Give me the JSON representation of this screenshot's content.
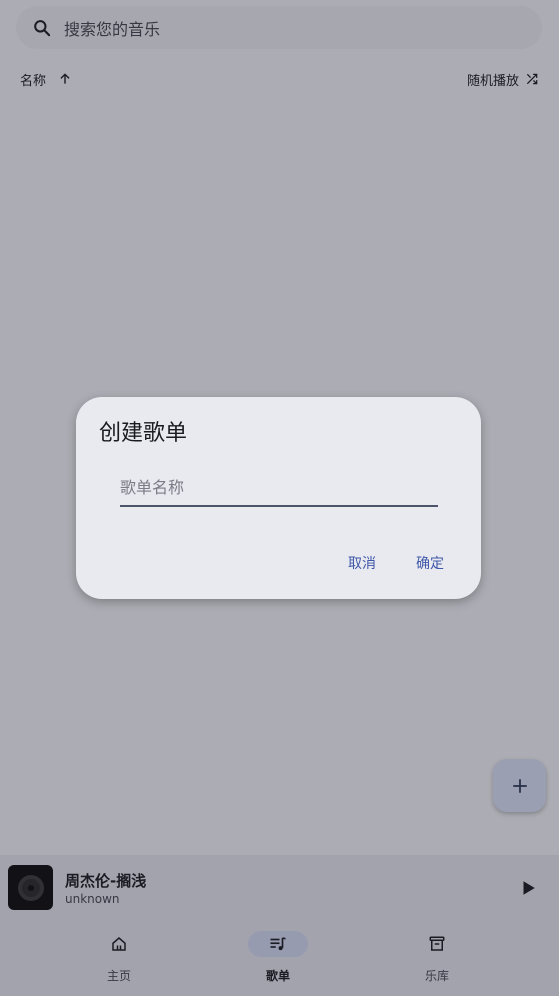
{
  "search": {
    "placeholder": "搜索您的音乐",
    "icon": "search-icon"
  },
  "sort": {
    "label": "名称",
    "direction_icon": "arrow-up-icon",
    "shuffle_label": "随机播放",
    "shuffle_icon": "shuffle-icon"
  },
  "fab": {
    "icon": "plus-icon"
  },
  "player": {
    "title": "周杰伦-搁浅",
    "artist": "unknown",
    "cover_icon": "vinyl-record-icon",
    "play_icon": "play-icon"
  },
  "nav": {
    "items": [
      {
        "label": "主页",
        "icon": "home-icon",
        "active": false
      },
      {
        "label": "歌单",
        "icon": "playlist-icon",
        "active": true
      },
      {
        "label": "乐库",
        "icon": "library-icon",
        "active": false
      }
    ]
  },
  "dialog": {
    "title": "创建歌单",
    "input_placeholder": "歌单名称",
    "input_value": "",
    "cancel_label": "取消",
    "confirm_label": "确定"
  },
  "colors": {
    "accent": "#3f57a8",
    "scrim": "#1e1e2d",
    "dialog_bg": "#e9eaf0",
    "nav_pill": "#d6dcf3"
  }
}
